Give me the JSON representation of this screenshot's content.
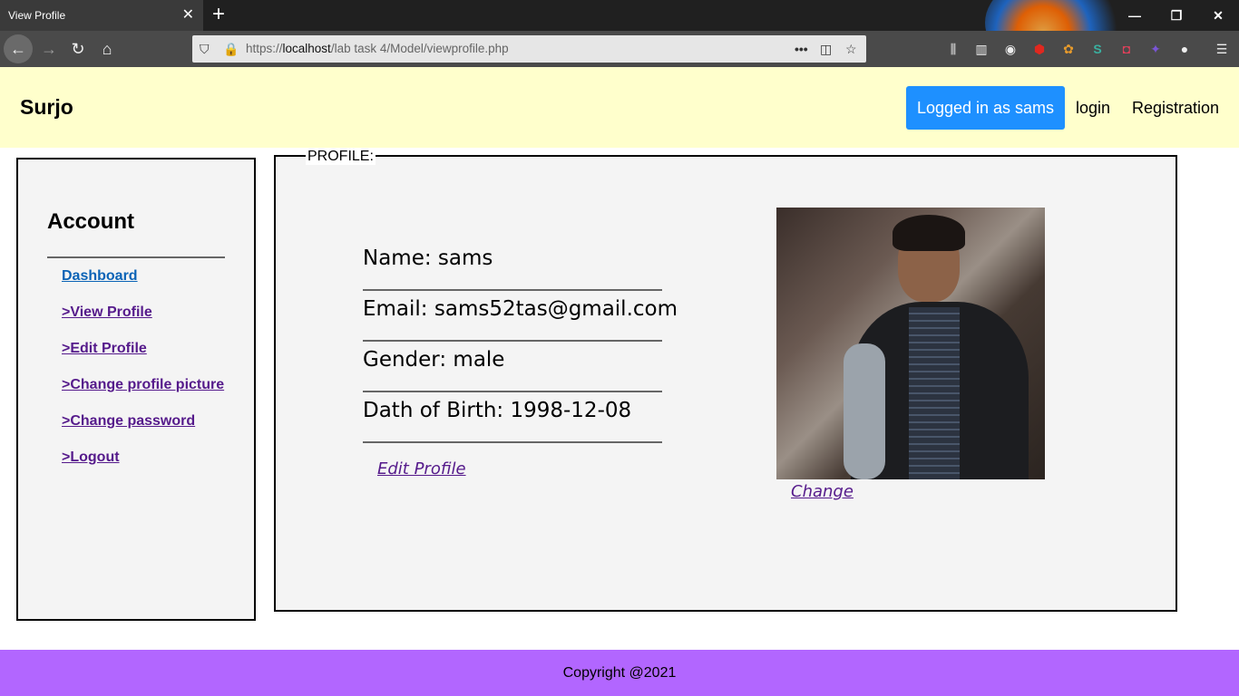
{
  "browser": {
    "tab_title": "View Profile",
    "tab_close": "✕",
    "new_tab": "+",
    "url_prefix": "https://",
    "url_host": "localhost",
    "url_path": "/lab task 4/Model/viewprofile.php",
    "page_actions": "•••"
  },
  "header": {
    "brand": "Surjo",
    "logged_in_label": "Logged in as sams",
    "login_label": "login",
    "registration_label": "Registration",
    "background": "#ffffcc",
    "button_color": "#1e90ff"
  },
  "sidebar": {
    "title": "Account",
    "items": [
      {
        "label": "Dashboard"
      },
      {
        "label": ">View Profile"
      },
      {
        "label": ">Edit Profile"
      },
      {
        "label": ">Change profile picture"
      },
      {
        "label": ">Change password"
      },
      {
        "label": ">Logout"
      }
    ]
  },
  "profile": {
    "legend": "PROFILE:",
    "fields": [
      {
        "text": "Name: sams"
      },
      {
        "text": "Email: sams52tas@gmail.com"
      },
      {
        "text": "Gender: male"
      },
      {
        "text": "Dath of Birth: 1998-12-08"
      }
    ],
    "edit_link": "Edit Profile",
    "change_link": "Change"
  },
  "footer": {
    "text": "Copyright @2021",
    "background": "#b266ff"
  }
}
